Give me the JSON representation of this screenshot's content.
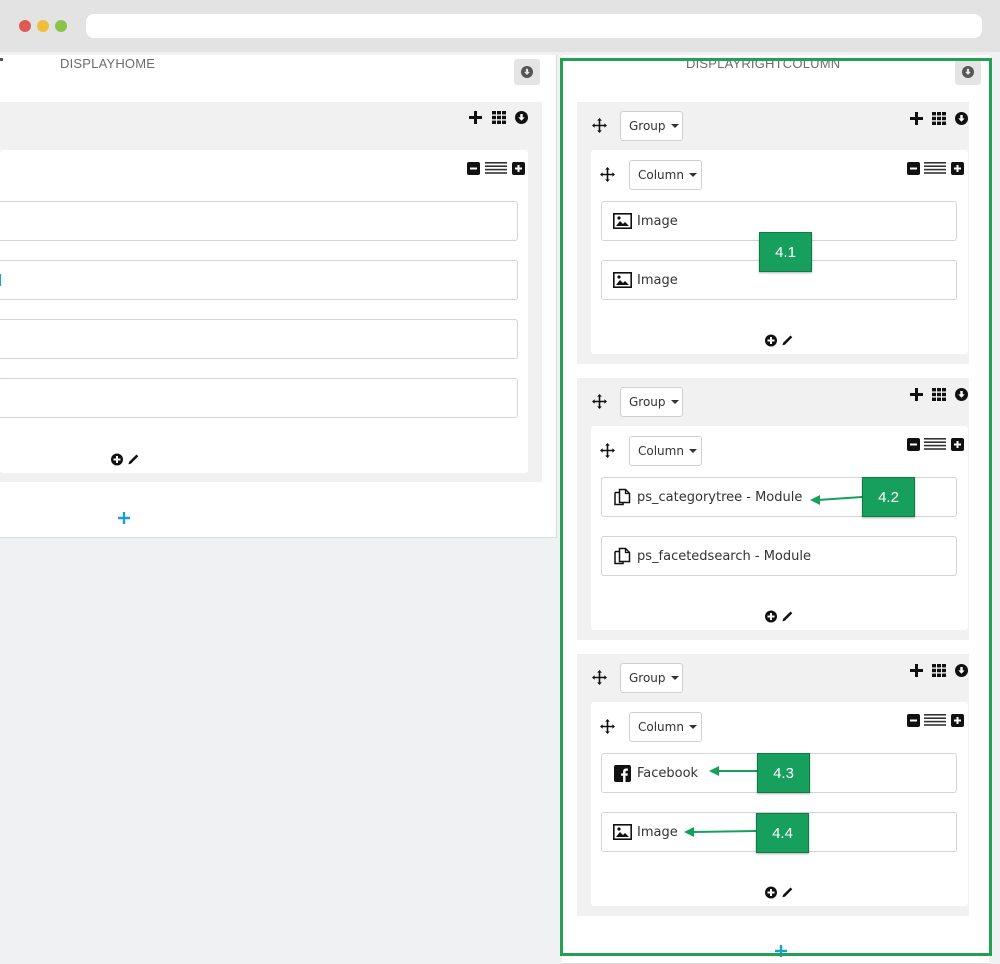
{
  "window": {
    "address": ""
  },
  "left_hook": {
    "title": "DISPLAYHOME"
  },
  "right_hook": {
    "title": "DISPLAYRIGHTCOLUMN",
    "groups": [
      {
        "group_label": "Group",
        "column_label": "Column",
        "modules": [
          {
            "label": "Image",
            "icon": "image-icon"
          },
          {
            "label": "Image",
            "icon": "image-icon"
          }
        ]
      },
      {
        "group_label": "Group",
        "column_label": "Column",
        "modules": [
          {
            "label": "ps_categorytree - Module",
            "icon": "module-copy-icon"
          },
          {
            "label": "ps_facetedsearch - Module",
            "icon": "module-copy-icon"
          }
        ]
      },
      {
        "group_label": "Group",
        "column_label": "Column",
        "modules": [
          {
            "label": "Facebook",
            "icon": "facebook-icon"
          },
          {
            "label": "Image",
            "icon": "image-icon"
          }
        ]
      }
    ]
  },
  "callouts": [
    "4.1",
    "4.2",
    "4.3",
    "4.4"
  ],
  "colors": {
    "accent_green": "#17a05d",
    "highlight_border": "#22a155",
    "add_plus_blue": "#1a9fd9"
  }
}
